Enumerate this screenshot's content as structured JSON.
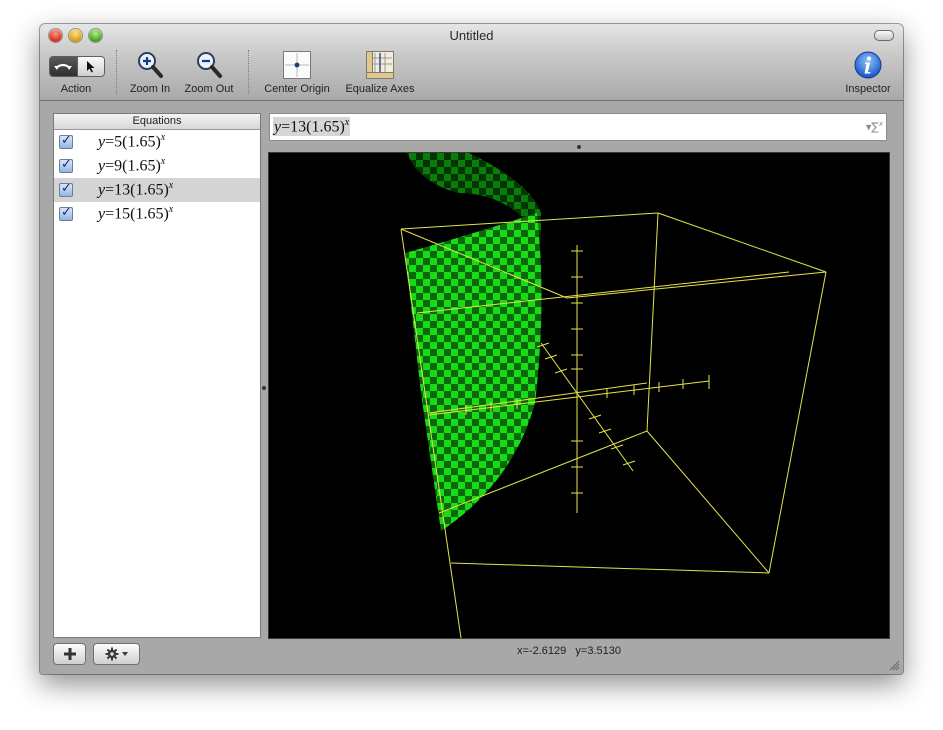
{
  "window": {
    "title": "Untitled"
  },
  "toolbar": {
    "action_label": "Action",
    "zoom_in_label": "Zoom In",
    "zoom_out_label": "Zoom Out",
    "center_origin_label": "Center Origin",
    "equalize_axes_label": "Equalize Axes",
    "inspector_label": "Inspector"
  },
  "sidebar": {
    "header": "Equations",
    "equations": [
      {
        "lhs": "y",
        "rhs": "=5(1.65)",
        "exp": "x",
        "checked": true,
        "selected": false
      },
      {
        "lhs": "y",
        "rhs": "=9(1.65)",
        "exp": "x",
        "checked": true,
        "selected": false
      },
      {
        "lhs": "y",
        "rhs": "=13(1.65)",
        "exp": "x",
        "checked": true,
        "selected": true
      },
      {
        "lhs": "y",
        "rhs": "=15(1.65)",
        "exp": "x",
        "checked": true,
        "selected": false
      }
    ]
  },
  "equation_field": {
    "lhs": "y",
    "rhs": "=13(1.65)",
    "exp": "x",
    "sigma_label": "∑"
  },
  "status": {
    "x_readout": "x=-2.6129",
    "y_readout": "y=3.5130"
  },
  "colors": {
    "surface": "#00ff00",
    "box": "#ffff33",
    "plot_bg": "#000000"
  },
  "icons": [
    "zoom-in-icon",
    "zoom-out-icon",
    "center-origin-icon",
    "equalize-axes-icon",
    "inspector-icon",
    "plus-icon",
    "gear-icon",
    "resize-grip-icon"
  ]
}
